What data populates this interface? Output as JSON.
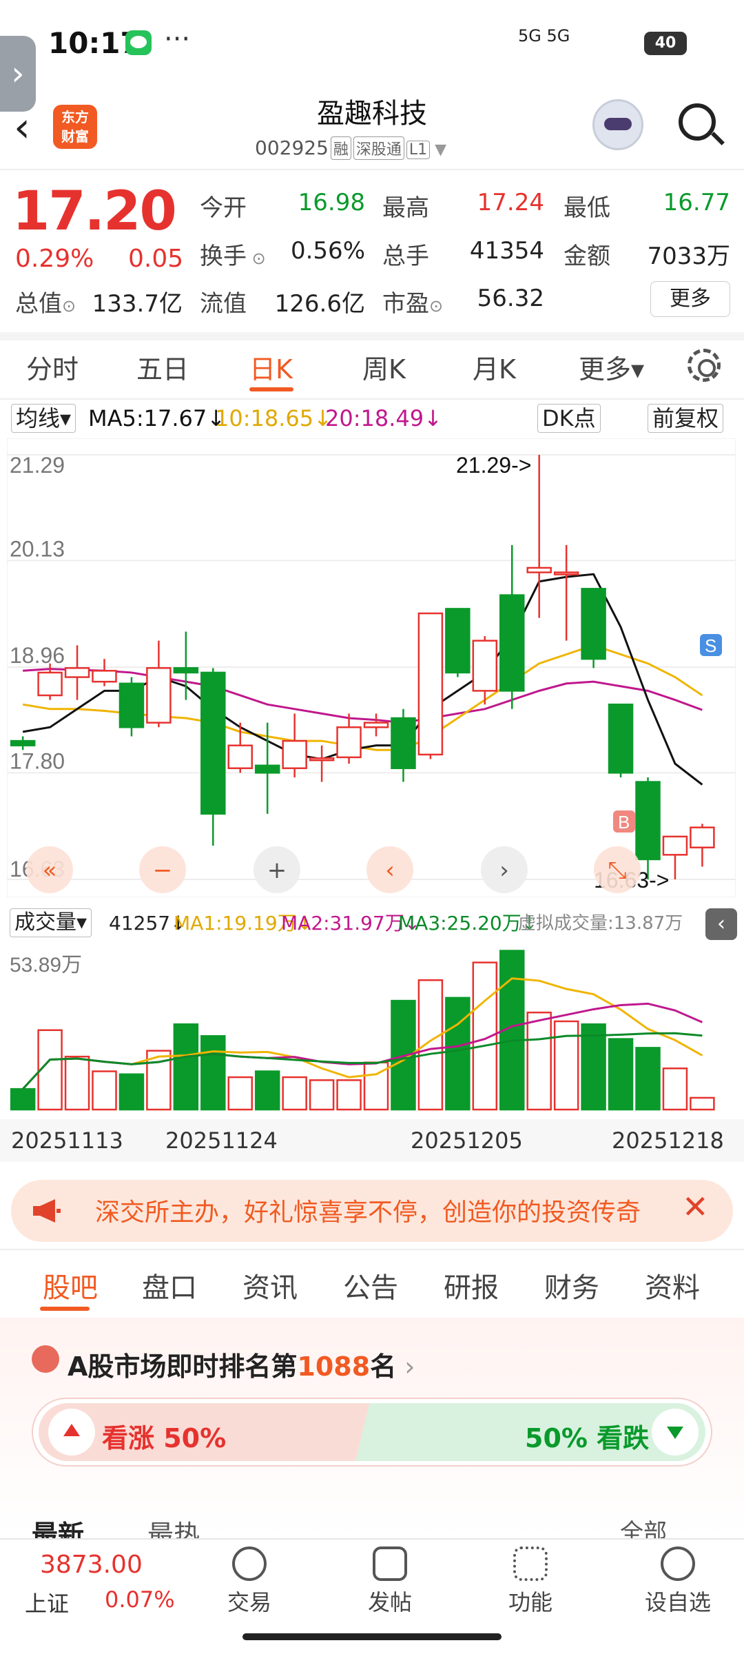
{
  "status": {
    "time": "10:17",
    "dots": "···",
    "signals": "5G 5G",
    "battery": "40"
  },
  "header": {
    "logo_line1": "东方",
    "logo_line2": "财富",
    "stock_name": "盈趣科技",
    "stock_code": "002925",
    "tags": [
      "融",
      "深股通",
      "L1"
    ]
  },
  "quote": {
    "price": "17.20",
    "pct": "0.29%",
    "chg": "0.05",
    "rows": [
      [
        {
          "l": "今开",
          "v": "16.98",
          "c": "green"
        },
        {
          "l": "最高",
          "v": "17.24",
          "c": "red"
        },
        {
          "l": "最低",
          "v": "16.77",
          "c": "green"
        }
      ],
      [
        {
          "l": "换手",
          "v": "0.56%",
          "c": "dark"
        },
        {
          "l": "总手",
          "v": "41354",
          "c": "dark"
        },
        {
          "l": "金额",
          "v": "7033万",
          "c": "dark"
        }
      ]
    ],
    "row3": {
      "total_label": "总值",
      "total_value": "133.7亿",
      "float_label": "流值",
      "float_value": "126.6亿",
      "pe_label": "市盈",
      "pe_value": "56.32"
    },
    "more": "更多"
  },
  "period_tabs": [
    "分时",
    "五日",
    "日K",
    "周K",
    "月K",
    "更多▾"
  ],
  "ma_row": {
    "selector": "均线▾",
    "ma5": "MA5:17.67↓",
    "ma10": "10:18.65↓",
    "ma20": "20:18.49↓",
    "dk": "DK点",
    "adjust": "前复权"
  },
  "colors": {
    "up": "#e6322e",
    "down": "#0a9a2b",
    "ma5": "#111111",
    "ma10": "#f0b400",
    "ma20": "#c0178c",
    "accent": "#f15a22"
  },
  "chart_data": {
    "type": "candlestick",
    "y_ticks": [
      "21.29",
      "20.13",
      "18.96",
      "17.80",
      "16.63"
    ],
    "ylim": [
      16.63,
      21.29
    ],
    "high_annotation": "21.29->",
    "low_annotation": "16.63->",
    "candles": [
      {
        "o": 18.15,
        "c": 18.1,
        "h": 18.2,
        "l": 18.05
      },
      {
        "o": 18.65,
        "c": 18.9,
        "h": 19.0,
        "l": 18.6
      },
      {
        "o": 18.85,
        "c": 18.95,
        "h": 19.2,
        "l": 18.6
      },
      {
        "o": 18.8,
        "c": 18.92,
        "h": 19.05,
        "l": 18.75
      },
      {
        "o": 18.78,
        "c": 18.3,
        "h": 18.85,
        "l": 18.2
      },
      {
        "o": 18.35,
        "c": 18.95,
        "h": 19.25,
        "l": 18.3
      },
      {
        "o": 18.95,
        "c": 18.9,
        "h": 19.35,
        "l": 18.6
      },
      {
        "o": 18.9,
        "c": 17.35,
        "h": 18.95,
        "l": 17.0
      },
      {
        "o": 17.85,
        "c": 18.1,
        "h": 18.35,
        "l": 17.8
      },
      {
        "o": 17.88,
        "c": 17.8,
        "h": 18.35,
        "l": 17.35
      },
      {
        "o": 17.85,
        "c": 18.15,
        "h": 18.45,
        "l": 17.75
      },
      {
        "o": 17.96,
        "c": 17.96,
        "h": 18.1,
        "l": 17.7
      },
      {
        "o": 17.97,
        "c": 18.3,
        "h": 18.45,
        "l": 17.9
      },
      {
        "o": 18.3,
        "c": 18.35,
        "h": 18.45,
        "l": 18.2
      },
      {
        "o": 18.4,
        "c": 17.85,
        "h": 18.5,
        "l": 17.7
      },
      {
        "o": 18.0,
        "c": 19.55,
        "h": 19.55,
        "l": 17.95
      },
      {
        "o": 19.6,
        "c": 18.9,
        "h": 19.6,
        "l": 18.85
      },
      {
        "o": 18.7,
        "c": 19.25,
        "h": 19.3,
        "l": 18.55
      },
      {
        "o": 19.75,
        "c": 18.7,
        "h": 20.3,
        "l": 18.5
      },
      {
        "o": 20.0,
        "c": 20.05,
        "h": 21.29,
        "l": 19.5
      },
      {
        "o": 20.0,
        "c": 20.0,
        "h": 20.3,
        "l": 19.25
      },
      {
        "o": 19.82,
        "c": 19.05,
        "h": 19.82,
        "l": 18.95
      },
      {
        "o": 18.55,
        "c": 17.8,
        "h": 18.55,
        "l": 17.75
      },
      {
        "o": 17.7,
        "c": 16.85,
        "h": 17.75,
        "l": 16.63
      },
      {
        "o": 16.9,
        "c": 17.1,
        "h": 17.1,
        "l": 16.63
      },
      {
        "o": 16.98,
        "c": 17.2,
        "h": 17.24,
        "l": 16.77
      }
    ],
    "ma5": [
      18.25,
      18.3,
      18.5,
      18.7,
      18.7,
      18.85,
      18.75,
      18.5,
      18.3,
      18.15,
      18.0,
      17.95,
      18.05,
      18.1,
      18.1,
      18.5,
      18.7,
      18.9,
      19.3,
      19.9,
      19.95,
      19.98,
      19.4,
      18.6,
      17.9,
      17.67
    ],
    "ma10": [
      18.55,
      18.5,
      18.5,
      18.48,
      18.45,
      18.42,
      18.4,
      18.35,
      18.25,
      18.2,
      18.15,
      18.15,
      18.1,
      18.05,
      18.05,
      18.2,
      18.4,
      18.6,
      18.8,
      19.0,
      19.1,
      19.2,
      19.1,
      19.0,
      18.85,
      18.65
    ],
    "ma20": [
      18.92,
      18.94,
      18.93,
      18.92,
      18.9,
      18.85,
      18.8,
      18.75,
      18.65,
      18.55,
      18.5,
      18.45,
      18.4,
      18.38,
      18.35,
      18.4,
      18.45,
      18.5,
      18.6,
      18.7,
      18.78,
      18.8,
      18.75,
      18.7,
      18.6,
      18.49
    ],
    "volume_label": "成交量▾",
    "vol_current": "41257↓",
    "vol_ma1": "MA1:19.19万↓",
    "vol_ma2": "MA2:31.97万↓",
    "vol_ma3": "MA3:25.20万↓",
    "vol_virtual": "虚拟成交量:13.87万",
    "vol_max_label": "53.89万",
    "vol_max": 53.89,
    "volumes": [
      7,
      27,
      18,
      13,
      12,
      20,
      29,
      25,
      11,
      13,
      11,
      10,
      10,
      16,
      37,
      44,
      38,
      50,
      54,
      33,
      30,
      29,
      24,
      21,
      14,
      4
    ],
    "dates": [
      "20251113",
      "20251124",
      "20251205",
      "20251218"
    ]
  },
  "banner": {
    "text": "深交所主办，好礼惊喜享不停，创造你的投资传奇"
  },
  "bottom_tabs": [
    "股吧",
    "盘口",
    "资讯",
    "公告",
    "研报",
    "财务",
    "资料"
  ],
  "ranking": {
    "prefix": "A股市场即时排名第",
    "rank": "1088",
    "suffix": "名",
    "up_label": "看涨 50%",
    "down_label": "50% 看跌"
  },
  "feed_tabs": {
    "latest": "最新",
    "hot": "最热",
    "all": "全部"
  },
  "index": {
    "value": "3873.00",
    "name": "上证",
    "pct": "0.07%"
  },
  "nav": [
    "交易",
    "发帖",
    "功能",
    "设自选"
  ]
}
